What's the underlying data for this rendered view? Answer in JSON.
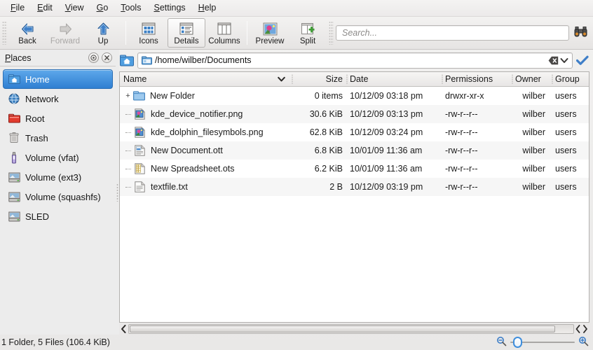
{
  "menubar": {
    "items": [
      {
        "label": "File",
        "accel": "F"
      },
      {
        "label": "Edit",
        "accel": "E"
      },
      {
        "label": "View",
        "accel": "V"
      },
      {
        "label": "Go",
        "accel": "G"
      },
      {
        "label": "Tools",
        "accel": "T"
      },
      {
        "label": "Settings",
        "accel": "S"
      },
      {
        "label": "Help",
        "accel": "H"
      }
    ]
  },
  "toolbar": {
    "back_label": "Back",
    "forward_label": "Forward",
    "up_label": "Up",
    "icons_label": "Icons",
    "details_label": "Details",
    "columns_label": "Columns",
    "preview_label": "Preview",
    "split_label": "Split",
    "active_view": "Details"
  },
  "search": {
    "placeholder": "Search...",
    "value": "",
    "icon": "binoculars-icon"
  },
  "places": {
    "title": "Places",
    "title_accel": "P",
    "header_buttons": [
      "settings-dot-icon",
      "close-icon"
    ],
    "items": [
      {
        "label": "Home",
        "icon": "home-folder-icon",
        "selected": true
      },
      {
        "label": "Network",
        "icon": "network-globe-icon",
        "selected": false
      },
      {
        "label": "Root",
        "icon": "root-folder-icon",
        "selected": false
      },
      {
        "label": "Trash",
        "icon": "trash-bin-icon",
        "selected": false
      },
      {
        "label": "Volume (vfat)",
        "icon": "usb-drive-icon",
        "selected": false
      },
      {
        "label": "Volume (ext3)",
        "icon": "hard-drive-icon",
        "selected": false
      },
      {
        "label": "Volume (squashfs)",
        "icon": "hard-drive-icon",
        "selected": false
      },
      {
        "label": "SLED",
        "icon": "hard-drive-icon",
        "selected": false
      }
    ]
  },
  "urlbar": {
    "path": "/home/wilber/Documents",
    "home_icon": "home-icon",
    "path_icon": "folder-small-icon",
    "clear_icon": "clear-icon",
    "dropdown_icon": "chevron-down-icon",
    "confirm_icon": "checkmark-icon"
  },
  "filelist": {
    "columns": [
      {
        "key": "name",
        "label": "Name",
        "sorted": true,
        "sort_icon": "chevron-down-icon"
      },
      {
        "key": "size",
        "label": "Size"
      },
      {
        "key": "date",
        "label": "Date"
      },
      {
        "key": "perm",
        "label": "Permissions"
      },
      {
        "key": "owner",
        "label": "Owner"
      },
      {
        "key": "group",
        "label": "Group"
      }
    ],
    "rows": [
      {
        "name": "New Folder",
        "size": "0 items",
        "date": "10/12/09 03:18 pm",
        "perm": "drwxr-xr-x",
        "owner": "wilber",
        "group": "users",
        "icon": "folder-icon",
        "expander": "+"
      },
      {
        "name": "kde_device_notifier.png",
        "size": "30.6 KiB",
        "date": "10/12/09 03:13 pm",
        "perm": "-rw-r--r--",
        "owner": "wilber",
        "group": "users",
        "icon": "image-file-icon",
        "expander": ""
      },
      {
        "name": "kde_dolphin_filesymbols.png",
        "size": "62.8 KiB",
        "date": "10/12/09 03:24 pm",
        "perm": "-rw-r--r--",
        "owner": "wilber",
        "group": "users",
        "icon": "image-file-icon",
        "expander": ""
      },
      {
        "name": "New Document.ott",
        "size": "6.8 KiB",
        "date": "10/01/09 11:36 am",
        "perm": "-rw-r--r--",
        "owner": "wilber",
        "group": "users",
        "icon": "document-file-icon",
        "expander": ""
      },
      {
        "name": "New Spreadsheet.ots",
        "size": "6.2 KiB",
        "date": "10/01/09 11:36 am",
        "perm": "-rw-r--r--",
        "owner": "wilber",
        "group": "users",
        "icon": "spreadsheet-file-icon",
        "expander": ""
      },
      {
        "name": "textfile.txt",
        "size": "2 B",
        "date": "10/12/09 03:19 pm",
        "perm": "-rw-r--r--",
        "owner": "wilber",
        "group": "users",
        "icon": "text-file-icon",
        "expander": ""
      }
    ]
  },
  "statusbar": {
    "text": "1 Folder, 5 Files (106.4 KiB)",
    "zoom_out_icon": "zoom-out-icon",
    "zoom_in_icon": "zoom-in-icon"
  },
  "colors": {
    "selection_blue": "#2f7fd2",
    "window_bg": "#efefef",
    "list_bg": "#ffffff",
    "row_alt": "#f6f6f6"
  }
}
